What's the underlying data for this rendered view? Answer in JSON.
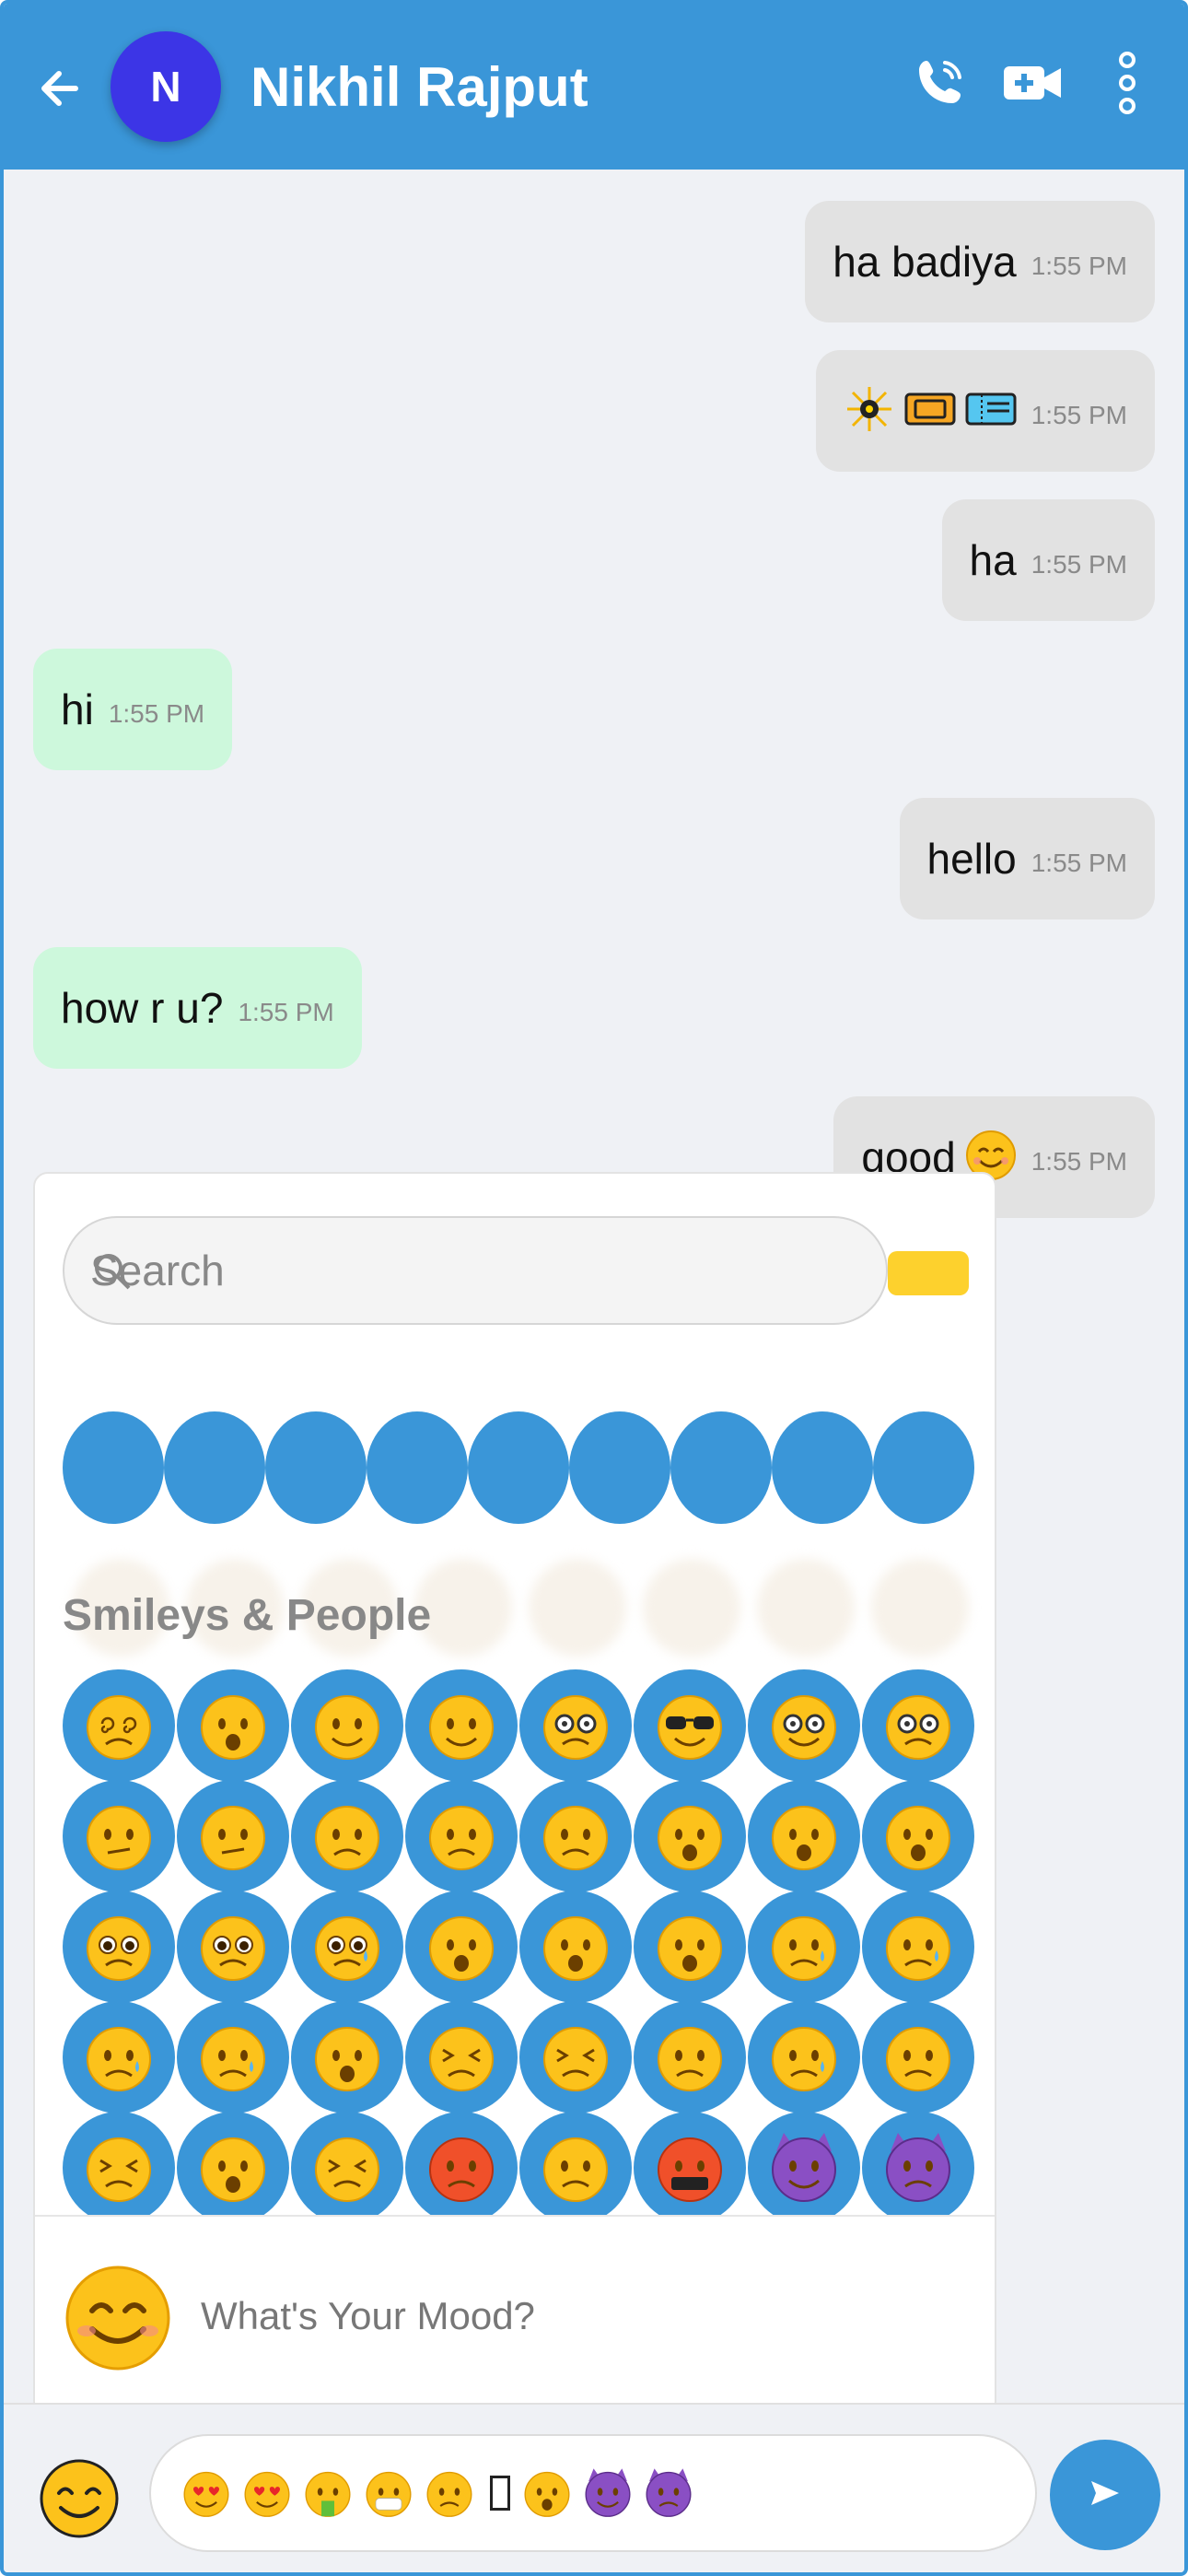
{
  "header": {
    "avatar_initial": "N",
    "contact_name": "Nikhil Rajput",
    "icons": [
      "back-arrow-icon",
      "phone-call-icon",
      "video-call-icon",
      "more-vertical-icon"
    ],
    "background": "#3a96d8"
  },
  "messages": [
    {
      "direction": "out",
      "text": "ha badiya",
      "time": "1:55 PM"
    },
    {
      "direction": "out",
      "text": "",
      "emojis": [
        "sparkler",
        "ticket",
        "ticket"
      ],
      "time": "1:55 PM"
    },
    {
      "direction": "out",
      "text": "ha",
      "time": "1:55 PM"
    },
    {
      "direction": "in",
      "text": "hi",
      "time": "1:55 PM"
    },
    {
      "direction": "out",
      "text": "hello",
      "time": "1:55 PM"
    },
    {
      "direction": "in",
      "text": "how r u?",
      "time": "1:55 PM"
    },
    {
      "direction": "out",
      "text": "good",
      "emojis": [
        "smiling-face"
      ],
      "time": "1:55 PM"
    }
  ],
  "emoji_picker": {
    "search_placeholder": "Search",
    "section_label": "Smileys & People",
    "footer_text": "What's Your Mood?",
    "grid": [
      [
        "face-with-spiral-eyes",
        "exploding-head",
        "cowboy-hat-face",
        "partying-face",
        "disguised-face",
        "smiling-face-with-sunglasses",
        "nerd-face",
        "face-with-monocle"
      ],
      [
        "confused-face",
        "face-with-diagonal-mouth",
        "worried-face",
        "slightly-frowning-face",
        "frowning-face",
        "face-with-open-mouth",
        "hushed-face",
        "astonished-face"
      ],
      [
        "flushed-face",
        "pleading-face",
        "face-holding-back-tears",
        "frowning-face-with-open-mouth",
        "anguished-face",
        "fearful-face",
        "anxious-face-with-sweat",
        "sad-but-relieved-face"
      ],
      [
        "crying-face",
        "loudly-crying-face",
        "face-screaming-in-fear",
        "confounded-face",
        "persevering-face",
        "disappointed-face",
        "downcast-face-with-sweat",
        "weary-face"
      ],
      [
        "tired-face",
        "yawning-face",
        "face-with-steam-from-nose",
        "pouting-face",
        "angry-face",
        "face-with-symbols-on-mouth",
        "smiling-face-with-horns",
        "angry-face-with-horns"
      ]
    ]
  },
  "composer": {
    "emojis": [
      "smiling-face-with-heart-eyes",
      "smiling-face-with-heart-eyes",
      "face-vomiting",
      "face-with-medical-mask",
      "worried-face",
      "unknown-glyph",
      "hushed-face",
      "smiling-face-with-horns",
      "angry-face-with-horns"
    ],
    "send_icon": "send-icon"
  }
}
